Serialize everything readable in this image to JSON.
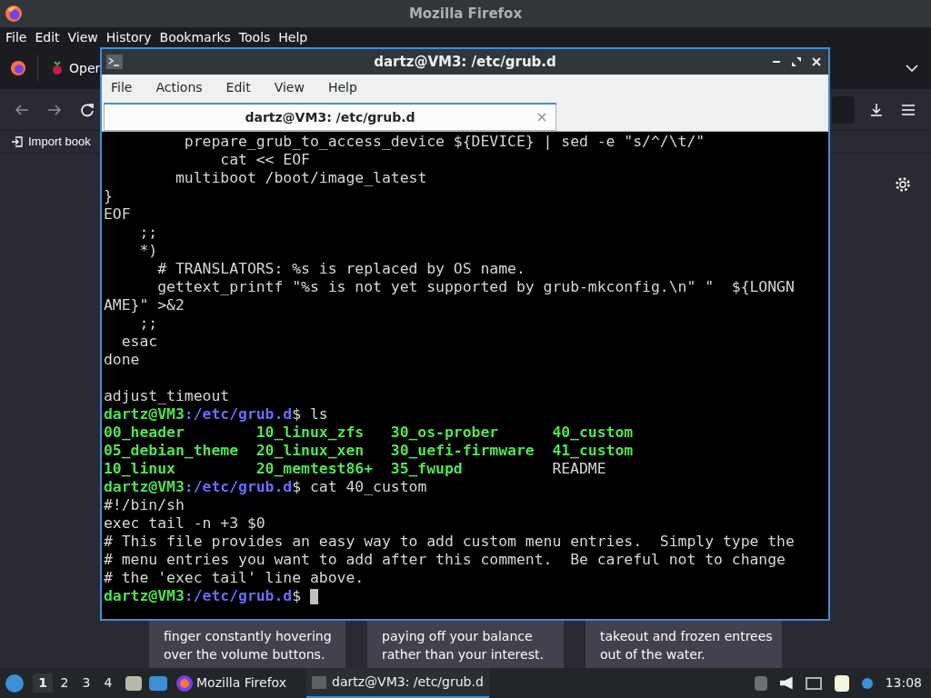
{
  "firefox": {
    "title": "Mozilla Firefox",
    "menu": [
      "File",
      "Edit",
      "View",
      "History",
      "Bookmarks",
      "Tools",
      "Help"
    ],
    "tab": {
      "label": "Oper"
    },
    "bookmark": "Import book",
    "cards": [
      {
        "lines": [
          "finger constantly hovering",
          "over the volume buttons."
        ]
      },
      {
        "lines": [
          "paying off your balance",
          "rather than your interest."
        ]
      },
      {
        "lines": [
          "takeout and frozen entrees",
          "out of the water."
        ]
      }
    ]
  },
  "terminal": {
    "title": "dartz@VM3: /etc/grub.d",
    "menu": [
      "File",
      "Actions",
      "Edit",
      "View",
      "Help"
    ],
    "tabs": [
      {
        "label": "dartz@VM3: /etc/grub.d",
        "selected": true
      }
    ],
    "lines": [
      {
        "segments": [
          {
            "text": "         prepare_grub_to_access_device ${DEVICE} | sed -e \"s/^/\\t/\"",
            "kind": "plain"
          }
        ]
      },
      {
        "segments": [
          {
            "text": "             cat << EOF",
            "kind": "plain"
          }
        ]
      },
      {
        "segments": [
          {
            "text": "        multiboot /boot/image_latest",
            "kind": "plain"
          }
        ]
      },
      {
        "segments": [
          {
            "text": "}",
            "kind": "plain"
          }
        ]
      },
      {
        "segments": [
          {
            "text": "EOF",
            "kind": "plain"
          }
        ]
      },
      {
        "segments": [
          {
            "text": "    ;;",
            "kind": "plain"
          }
        ]
      },
      {
        "segments": [
          {
            "text": "    *)",
            "kind": "plain"
          }
        ]
      },
      {
        "segments": [
          {
            "text": "      # TRANSLATORS: %s is replaced by OS name.",
            "kind": "plain"
          }
        ]
      },
      {
        "segments": [
          {
            "text": "      gettext_printf \"%s is not yet supported by grub-mkconfig.\\n\" \"  ${LONGN",
            "kind": "plain"
          }
        ]
      },
      {
        "segments": [
          {
            "text": "AME}\" >&2",
            "kind": "plain"
          }
        ]
      },
      {
        "segments": [
          {
            "text": "    ;;",
            "kind": "plain"
          }
        ]
      },
      {
        "segments": [
          {
            "text": "  esac",
            "kind": "plain"
          }
        ]
      },
      {
        "segments": [
          {
            "text": "done",
            "kind": "plain"
          }
        ]
      },
      {
        "blank": true
      },
      {
        "segments": [
          {
            "text": "adjust_timeout",
            "kind": "plain"
          }
        ]
      },
      {
        "segments": [
          {
            "text": "dartz@VM3",
            "kind": "user"
          },
          {
            "text": ":/etc/grub.d",
            "kind": "path"
          },
          {
            "text": "$ ls",
            "kind": "plain"
          }
        ]
      },
      {
        "entries": [
          {
            "text": "00_header",
            "kind": "exec"
          },
          {
            "text": "10_linux_zfs",
            "kind": "exec"
          },
          {
            "text": "30_os-prober",
            "kind": "exec"
          },
          {
            "text": "40_custom",
            "kind": "exec"
          }
        ]
      },
      {
        "entries": [
          {
            "text": "05_debian_theme",
            "kind": "exec"
          },
          {
            "text": "20_linux_xen",
            "kind": "exec"
          },
          {
            "text": "30_uefi-firmware",
            "kind": "exec"
          },
          {
            "text": "41_custom",
            "kind": "exec"
          }
        ]
      },
      {
        "entries": [
          {
            "text": "10_linux",
            "kind": "exec"
          },
          {
            "text": "20_memtest86+",
            "kind": "exec"
          },
          {
            "text": "35_fwupd",
            "kind": "exec"
          },
          {
            "text": "README",
            "kind": "plain"
          }
        ]
      },
      {
        "segments": [
          {
            "text": "dartz@VM3",
            "kind": "user"
          },
          {
            "text": ":/etc/grub.d",
            "kind": "path"
          },
          {
            "text": "$ cat 40_custom",
            "kind": "plain"
          }
        ]
      },
      {
        "segments": [
          {
            "text": "#!/bin/sh",
            "kind": "plain"
          }
        ]
      },
      {
        "segments": [
          {
            "text": "exec tail -n +3 $0",
            "kind": "plain"
          }
        ]
      },
      {
        "segments": [
          {
            "text": "# This file provides an easy way to add custom menu entries.  Simply type the",
            "kind": "plain"
          }
        ]
      },
      {
        "segments": [
          {
            "text": "# menu entries you want to add after this comment.  Be careful not to change",
            "kind": "plain"
          }
        ]
      },
      {
        "segments": [
          {
            "text": "# the 'exec tail' line above.",
            "kind": "plain"
          }
        ]
      },
      {
        "segments": [
          {
            "text": "dartz@VM3",
            "kind": "user"
          },
          {
            "text": ":/etc/grub.d",
            "kind": "path"
          },
          {
            "text": "$",
            "kind": "plain"
          }
        ],
        "cursor": true
      }
    ]
  },
  "taskbar": {
    "workspaces": [
      {
        "label": "1",
        "selected": true
      },
      {
        "label": "2",
        "selected": false
      },
      {
        "label": "3",
        "selected": false
      },
      {
        "label": "4",
        "selected": false
      }
    ],
    "tasks": [
      {
        "label": "Mozilla Firefox",
        "kind": "firefox",
        "selected": false
      },
      {
        "label": "dartz@VM3: /etc/grub.d",
        "kind": "terminal",
        "selected": true
      }
    ],
    "clock": "13:08"
  }
}
